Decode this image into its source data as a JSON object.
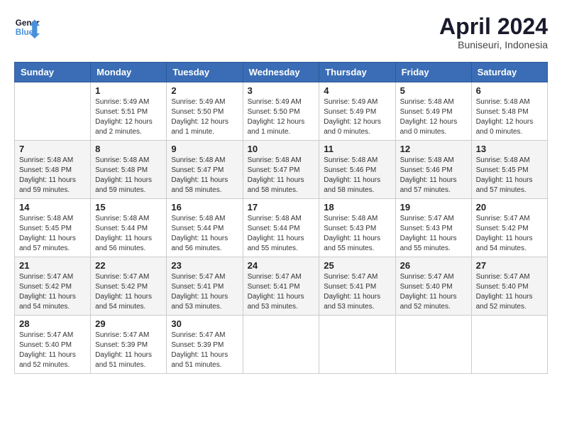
{
  "header": {
    "logo_line1": "General",
    "logo_line2": "Blue",
    "month": "April 2024",
    "location": "Buniseuri, Indonesia"
  },
  "weekdays": [
    "Sunday",
    "Monday",
    "Tuesday",
    "Wednesday",
    "Thursday",
    "Friday",
    "Saturday"
  ],
  "weeks": [
    [
      {
        "day": "",
        "sunrise": "",
        "sunset": "",
        "daylight": ""
      },
      {
        "day": "1",
        "sunrise": "Sunrise: 5:49 AM",
        "sunset": "Sunset: 5:51 PM",
        "daylight": "Daylight: 12 hours and 2 minutes."
      },
      {
        "day": "2",
        "sunrise": "Sunrise: 5:49 AM",
        "sunset": "Sunset: 5:50 PM",
        "daylight": "Daylight: 12 hours and 1 minute."
      },
      {
        "day": "3",
        "sunrise": "Sunrise: 5:49 AM",
        "sunset": "Sunset: 5:50 PM",
        "daylight": "Daylight: 12 hours and 1 minute."
      },
      {
        "day": "4",
        "sunrise": "Sunrise: 5:49 AM",
        "sunset": "Sunset: 5:49 PM",
        "daylight": "Daylight: 12 hours and 0 minutes."
      },
      {
        "day": "5",
        "sunrise": "Sunrise: 5:48 AM",
        "sunset": "Sunset: 5:49 PM",
        "daylight": "Daylight: 12 hours and 0 minutes."
      },
      {
        "day": "6",
        "sunrise": "Sunrise: 5:48 AM",
        "sunset": "Sunset: 5:48 PM",
        "daylight": "Daylight: 12 hours and 0 minutes."
      }
    ],
    [
      {
        "day": "7",
        "sunrise": "Sunrise: 5:48 AM",
        "sunset": "Sunset: 5:48 PM",
        "daylight": "Daylight: 11 hours and 59 minutes."
      },
      {
        "day": "8",
        "sunrise": "Sunrise: 5:48 AM",
        "sunset": "Sunset: 5:48 PM",
        "daylight": "Daylight: 11 hours and 59 minutes."
      },
      {
        "day": "9",
        "sunrise": "Sunrise: 5:48 AM",
        "sunset": "Sunset: 5:47 PM",
        "daylight": "Daylight: 11 hours and 58 minutes."
      },
      {
        "day": "10",
        "sunrise": "Sunrise: 5:48 AM",
        "sunset": "Sunset: 5:47 PM",
        "daylight": "Daylight: 11 hours and 58 minutes."
      },
      {
        "day": "11",
        "sunrise": "Sunrise: 5:48 AM",
        "sunset": "Sunset: 5:46 PM",
        "daylight": "Daylight: 11 hours and 58 minutes."
      },
      {
        "day": "12",
        "sunrise": "Sunrise: 5:48 AM",
        "sunset": "Sunset: 5:46 PM",
        "daylight": "Daylight: 11 hours and 57 minutes."
      },
      {
        "day": "13",
        "sunrise": "Sunrise: 5:48 AM",
        "sunset": "Sunset: 5:45 PM",
        "daylight": "Daylight: 11 hours and 57 minutes."
      }
    ],
    [
      {
        "day": "14",
        "sunrise": "Sunrise: 5:48 AM",
        "sunset": "Sunset: 5:45 PM",
        "daylight": "Daylight: 11 hours and 57 minutes."
      },
      {
        "day": "15",
        "sunrise": "Sunrise: 5:48 AM",
        "sunset": "Sunset: 5:44 PM",
        "daylight": "Daylight: 11 hours and 56 minutes."
      },
      {
        "day": "16",
        "sunrise": "Sunrise: 5:48 AM",
        "sunset": "Sunset: 5:44 PM",
        "daylight": "Daylight: 11 hours and 56 minutes."
      },
      {
        "day": "17",
        "sunrise": "Sunrise: 5:48 AM",
        "sunset": "Sunset: 5:44 PM",
        "daylight": "Daylight: 11 hours and 55 minutes."
      },
      {
        "day": "18",
        "sunrise": "Sunrise: 5:48 AM",
        "sunset": "Sunset: 5:43 PM",
        "daylight": "Daylight: 11 hours and 55 minutes."
      },
      {
        "day": "19",
        "sunrise": "Sunrise: 5:47 AM",
        "sunset": "Sunset: 5:43 PM",
        "daylight": "Daylight: 11 hours and 55 minutes."
      },
      {
        "day": "20",
        "sunrise": "Sunrise: 5:47 AM",
        "sunset": "Sunset: 5:42 PM",
        "daylight": "Daylight: 11 hours and 54 minutes."
      }
    ],
    [
      {
        "day": "21",
        "sunrise": "Sunrise: 5:47 AM",
        "sunset": "Sunset: 5:42 PM",
        "daylight": "Daylight: 11 hours and 54 minutes."
      },
      {
        "day": "22",
        "sunrise": "Sunrise: 5:47 AM",
        "sunset": "Sunset: 5:42 PM",
        "daylight": "Daylight: 11 hours and 54 minutes."
      },
      {
        "day": "23",
        "sunrise": "Sunrise: 5:47 AM",
        "sunset": "Sunset: 5:41 PM",
        "daylight": "Daylight: 11 hours and 53 minutes."
      },
      {
        "day": "24",
        "sunrise": "Sunrise: 5:47 AM",
        "sunset": "Sunset: 5:41 PM",
        "daylight": "Daylight: 11 hours and 53 minutes."
      },
      {
        "day": "25",
        "sunrise": "Sunrise: 5:47 AM",
        "sunset": "Sunset: 5:41 PM",
        "daylight": "Daylight: 11 hours and 53 minutes."
      },
      {
        "day": "26",
        "sunrise": "Sunrise: 5:47 AM",
        "sunset": "Sunset: 5:40 PM",
        "daylight": "Daylight: 11 hours and 52 minutes."
      },
      {
        "day": "27",
        "sunrise": "Sunrise: 5:47 AM",
        "sunset": "Sunset: 5:40 PM",
        "daylight": "Daylight: 11 hours and 52 minutes."
      }
    ],
    [
      {
        "day": "28",
        "sunrise": "Sunrise: 5:47 AM",
        "sunset": "Sunset: 5:40 PM",
        "daylight": "Daylight: 11 hours and 52 minutes."
      },
      {
        "day": "29",
        "sunrise": "Sunrise: 5:47 AM",
        "sunset": "Sunset: 5:39 PM",
        "daylight": "Daylight: 11 hours and 51 minutes."
      },
      {
        "day": "30",
        "sunrise": "Sunrise: 5:47 AM",
        "sunset": "Sunset: 5:39 PM",
        "daylight": "Daylight: 11 hours and 51 minutes."
      },
      {
        "day": "",
        "sunrise": "",
        "sunset": "",
        "daylight": ""
      },
      {
        "day": "",
        "sunrise": "",
        "sunset": "",
        "daylight": ""
      },
      {
        "day": "",
        "sunrise": "",
        "sunset": "",
        "daylight": ""
      },
      {
        "day": "",
        "sunrise": "",
        "sunset": "",
        "daylight": ""
      }
    ]
  ]
}
